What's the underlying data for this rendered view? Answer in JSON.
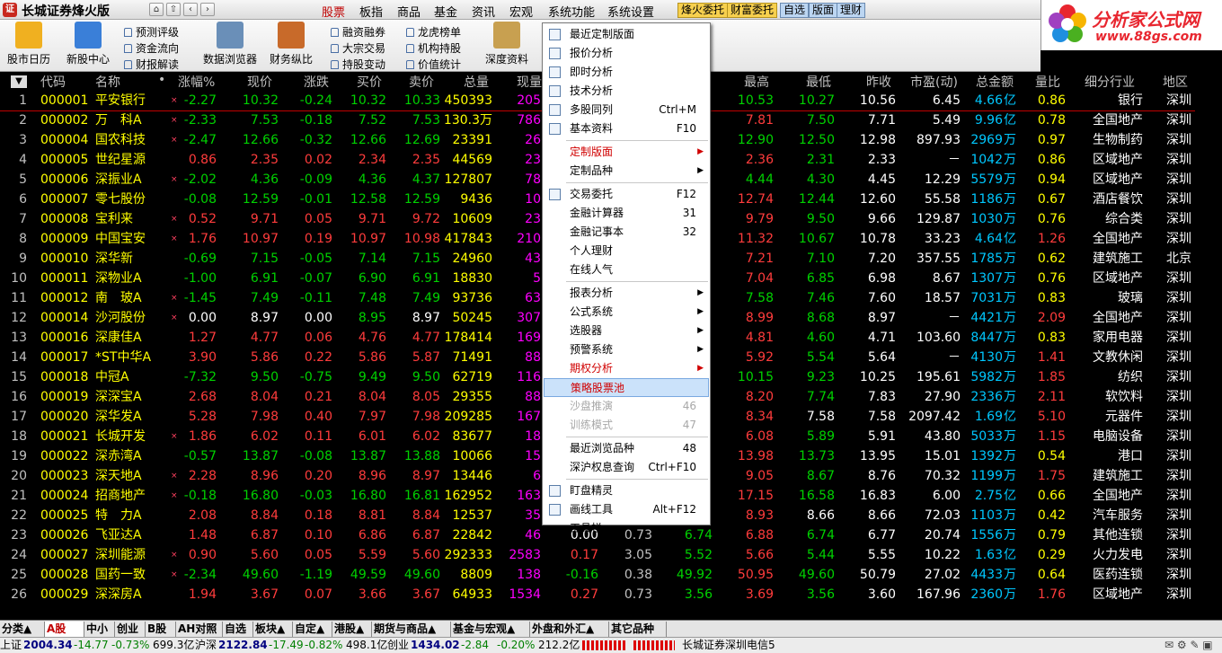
{
  "title": {
    "app": "长城证券烽火版",
    "logo": "证"
  },
  "menus": [
    "股票",
    "板指",
    "商品",
    "基金",
    "资讯",
    "宏观",
    "系统功能",
    "系统设置"
  ],
  "trade_buttons": [
    "烽火委托",
    "财富委托",
    "自选",
    "版面",
    "理财"
  ],
  "brand": {
    "name": "分析家公式网",
    "url": "www.88gs.com"
  },
  "toolbar": {
    "big": [
      "股市日历",
      "新股中心",
      "数据浏览器",
      "财务纵比",
      "深度资料"
    ],
    "small": [
      "预测评级",
      "资金流向",
      "财报解读",
      "融资融券",
      "大宗交易",
      "持股变动",
      "龙虎榜单",
      "机构持股",
      "价值统计"
    ]
  },
  "headers": {
    "idx": "▼",
    "code": "代码",
    "name": "名称",
    "dot": "•",
    "chg_pct": "涨幅%",
    "price": "现价",
    "chg": "涨跌",
    "bid": "买价",
    "ask": "卖价",
    "vol": "总量",
    "cur": "现量",
    "high": "最高",
    "low": "最低",
    "prev": "昨收",
    "pe": "市盈(动)",
    "amount": "总金额",
    "vr": "量比",
    "industry": "细分行业",
    "region": "地区"
  },
  "rows": [
    [
      "1",
      "000001",
      "平安银行",
      "×",
      "-2.27",
      "10.32",
      "-0.24",
      "10.32",
      "10.33",
      "450393",
      "205",
      "",
      "",
      "",
      "",
      "10.53",
      "10.27",
      "10.56",
      "6.45",
      "4.66",
      "亿",
      "0.86",
      "银行",
      "深圳"
    ],
    [
      "2",
      "000002",
      "万　科A",
      "×",
      "-2.33",
      "7.53",
      "-0.18",
      "7.52",
      "7.53",
      "130.3万",
      "786",
      "",
      "",
      "",
      "",
      "7.81",
      "7.50",
      "7.71",
      "5.49",
      "9.96",
      "亿",
      "0.78",
      "全国地产",
      "深圳"
    ],
    [
      "3",
      "000004",
      "国农科技",
      "×",
      "-2.47",
      "12.66",
      "-0.32",
      "12.66",
      "12.69",
      "23391",
      "26",
      "",
      "",
      "",
      "",
      "12.90",
      "12.50",
      "12.98",
      "897.93",
      "2969",
      "万",
      "0.97",
      "生物制药",
      "深圳"
    ],
    [
      "4",
      "000005",
      "世纪星源",
      "",
      "0.86",
      "2.35",
      "0.02",
      "2.34",
      "2.35",
      "44569",
      "23",
      "",
      "",
      "",
      "",
      "2.36",
      "2.31",
      "2.33",
      "－",
      "1042",
      "万",
      "0.86",
      "区域地产",
      "深圳"
    ],
    [
      "5",
      "000006",
      "深振业A",
      "×",
      "-2.02",
      "4.36",
      "-0.09",
      "4.36",
      "4.37",
      "127807",
      "78",
      "",
      "",
      "",
      "",
      "4.44",
      "4.30",
      "4.45",
      "12.29",
      "5579",
      "万",
      "0.94",
      "区域地产",
      "深圳"
    ],
    [
      "6",
      "000007",
      "零七股份",
      "",
      "-0.08",
      "12.59",
      "-0.01",
      "12.58",
      "12.59",
      "9436",
      "10",
      "",
      "",
      "",
      "",
      "12.74",
      "12.44",
      "12.60",
      "55.58",
      "1186",
      "万",
      "0.67",
      "酒店餐饮",
      "深圳"
    ],
    [
      "7",
      "000008",
      "宝利来",
      "×",
      "0.52",
      "9.71",
      "0.05",
      "9.71",
      "9.72",
      "10609",
      "23",
      "",
      "",
      "",
      "",
      "9.79",
      "9.50",
      "9.66",
      "129.87",
      "1030",
      "万",
      "0.76",
      "综合类",
      "深圳"
    ],
    [
      "8",
      "000009",
      "中国宝安",
      "×",
      "1.76",
      "10.97",
      "0.19",
      "10.97",
      "10.98",
      "417843",
      "210",
      "",
      "",
      "",
      "",
      "11.32",
      "10.67",
      "10.78",
      "33.23",
      "4.64",
      "亿",
      "1.26",
      "全国地产",
      "深圳"
    ],
    [
      "9",
      "000010",
      "深华新",
      "",
      "-0.69",
      "7.15",
      "-0.05",
      "7.14",
      "7.15",
      "24960",
      "43",
      "",
      "",
      "",
      "",
      "7.21",
      "7.10",
      "7.20",
      "357.55",
      "1785",
      "万",
      "0.62",
      "建筑施工",
      "北京"
    ],
    [
      "10",
      "000011",
      "深物业A",
      "",
      "-1.00",
      "6.91",
      "-0.07",
      "6.90",
      "6.91",
      "18830",
      "5",
      "",
      "",
      "",
      "",
      "7.04",
      "6.85",
      "6.98",
      "8.67",
      "1307",
      "万",
      "0.76",
      "区域地产",
      "深圳"
    ],
    [
      "11",
      "000012",
      "南　玻A",
      "×",
      "-1.45",
      "7.49",
      "-0.11",
      "7.48",
      "7.49",
      "93736",
      "63",
      "",
      "",
      "",
      "",
      "7.58",
      "7.46",
      "7.60",
      "18.57",
      "7031",
      "万",
      "0.83",
      "玻璃",
      "深圳"
    ],
    [
      "12",
      "000014",
      "沙河股份",
      "×",
      "0.00",
      "8.97",
      "0.00",
      "8.95",
      "8.97",
      "50245",
      "307",
      "",
      "",
      "",
      "",
      "8.99",
      "8.68",
      "8.97",
      "－",
      "4421",
      "万",
      "2.09",
      "全国地产",
      "深圳"
    ],
    [
      "13",
      "000016",
      "深康佳A",
      "",
      "1.27",
      "4.77",
      "0.06",
      "4.76",
      "4.77",
      "178414",
      "169",
      "",
      "",
      "",
      "",
      "4.81",
      "4.60",
      "4.71",
      "103.60",
      "8447",
      "万",
      "0.83",
      "家用电器",
      "深圳"
    ],
    [
      "14",
      "000017",
      "*ST中华A",
      "",
      "3.90",
      "5.86",
      "0.22",
      "5.86",
      "5.87",
      "71491",
      "88",
      "",
      "",
      "",
      "",
      "5.92",
      "5.54",
      "5.64",
      "－",
      "4130",
      "万",
      "1.41",
      "文教休闲",
      "深圳"
    ],
    [
      "15",
      "000018",
      "中冠A",
      "",
      "-7.32",
      "9.50",
      "-0.75",
      "9.49",
      "9.50",
      "62719",
      "116",
      "",
      "",
      "",
      "",
      "10.15",
      "9.23",
      "10.25",
      "195.61",
      "5982",
      "万",
      "1.85",
      "纺织",
      "深圳"
    ],
    [
      "16",
      "000019",
      "深深宝A",
      "",
      "2.68",
      "8.04",
      "0.21",
      "8.04",
      "8.05",
      "29355",
      "88",
      "",
      "",
      "",
      "",
      "8.20",
      "7.74",
      "7.83",
      "27.90",
      "2336",
      "万",
      "2.11",
      "软饮料",
      "深圳"
    ],
    [
      "17",
      "000020",
      "深华发A",
      "",
      "5.28",
      "7.98",
      "0.40",
      "7.97",
      "7.98",
      "209285",
      "167",
      "",
      "",
      "",
      "",
      "8.34",
      "7.58",
      "7.58",
      "2097.42",
      "1.69",
      "亿",
      "5.10",
      "元器件",
      "深圳"
    ],
    [
      "18",
      "000021",
      "长城开发",
      "×",
      "1.86",
      "6.02",
      "0.11",
      "6.01",
      "6.02",
      "83677",
      "18",
      "",
      "",
      "",
      "",
      "6.08",
      "5.89",
      "5.91",
      "43.80",
      "5033",
      "万",
      "1.15",
      "电脑设备",
      "深圳"
    ],
    [
      "19",
      "000022",
      "深赤湾A",
      "",
      "-0.57",
      "13.87",
      "-0.08",
      "13.87",
      "13.88",
      "10066",
      "15",
      "",
      "",
      "",
      "",
      "13.98",
      "13.73",
      "13.95",
      "15.01",
      "1392",
      "万",
      "0.54",
      "港口",
      "深圳"
    ],
    [
      "20",
      "000023",
      "深天地A",
      "×",
      "2.28",
      "8.96",
      "0.20",
      "8.96",
      "8.97",
      "13446",
      "6",
      "",
      "",
      "",
      "",
      "9.05",
      "8.67",
      "8.76",
      "70.32",
      "1199",
      "万",
      "1.75",
      "建筑施工",
      "深圳"
    ],
    [
      "21",
      "000024",
      "招商地产",
      "×",
      "-0.18",
      "16.80",
      "-0.03",
      "16.80",
      "16.81",
      "162952",
      "163",
      "",
      "",
      "",
      "",
      "17.15",
      "16.58",
      "16.83",
      "6.00",
      "2.75",
      "亿",
      "0.66",
      "全国地产",
      "深圳"
    ],
    [
      "22",
      "000025",
      "特　力A",
      "",
      "2.08",
      "8.84",
      "0.18",
      "8.81",
      "8.84",
      "12537",
      "35",
      "",
      "",
      "",
      "",
      "8.93",
      "8.66",
      "8.66",
      "72.03",
      "1103",
      "万",
      "0.42",
      "汽车服务",
      "深圳"
    ],
    [
      "23",
      "000026",
      "飞亚达A",
      "",
      "1.48",
      "6.87",
      "0.10",
      "6.86",
      "6.87",
      "22842",
      "46",
      "0.00",
      "0.73",
      "6.74",
      "",
      "6.88",
      "6.74",
      "6.77",
      "20.74",
      "1556",
      "万",
      "0.79",
      "其他连锁",
      "深圳"
    ],
    [
      "24",
      "000027",
      "深圳能源",
      "×",
      "0.90",
      "5.60",
      "0.05",
      "5.59",
      "5.60",
      "292333",
      "2583",
      "0.17",
      "3.05",
      "5.52",
      "",
      "5.66",
      "5.44",
      "5.55",
      "10.22",
      "1.63",
      "亿",
      "0.29",
      "火力发电",
      "深圳"
    ],
    [
      "25",
      "000028",
      "国药一致",
      "×",
      "-2.34",
      "49.60",
      "-1.19",
      "49.59",
      "49.60",
      "8809",
      "138",
      "-0.16",
      "0.38",
      "49.92",
      "",
      "50.95",
      "49.60",
      "50.79",
      "27.02",
      "4433",
      "万",
      "0.64",
      "医药连锁",
      "深圳"
    ],
    [
      "26",
      "000029",
      "深深房A",
      "",
      "1.94",
      "3.67",
      "0.07",
      "3.66",
      "3.67",
      "64933",
      "1534",
      "0.27",
      "0.73",
      "3.56",
      "",
      "3.69",
      "3.56",
      "3.60",
      "167.96",
      "2360",
      "万",
      "1.76",
      "区域地产",
      "深圳"
    ]
  ],
  "popup_menu": [
    {
      "label": "最近定制版面",
      "shortcut": "",
      "sub": false,
      "style": "",
      "icon": true
    },
    {
      "label": "报价分析",
      "shortcut": "",
      "sub": false,
      "style": "",
      "icon": true
    },
    {
      "label": "即时分析",
      "shortcut": "",
      "sub": false,
      "style": "",
      "icon": true
    },
    {
      "label": "技术分析",
      "shortcut": "",
      "sub": false,
      "style": "",
      "icon": true
    },
    {
      "label": "多股同列",
      "shortcut": "Ctrl+M",
      "sub": false,
      "style": "",
      "icon": true
    },
    {
      "label": "基本资料",
      "shortcut": "F10",
      "sub": false,
      "style": "",
      "icon": true
    },
    {
      "sep": true
    },
    {
      "label": "定制版面",
      "shortcut": "",
      "sub": true,
      "style": "red",
      "icon": false
    },
    {
      "label": "定制品种",
      "shortcut": "",
      "sub": true,
      "style": "",
      "icon": false
    },
    {
      "sep": true
    },
    {
      "label": "交易委托",
      "shortcut": "F12",
      "sub": false,
      "style": "",
      "icon": true
    },
    {
      "label": "金融计算器",
      "shortcut": "31",
      "sub": false,
      "style": "",
      "icon": false
    },
    {
      "label": "金融记事本",
      "shortcut": "32",
      "sub": false,
      "style": "",
      "icon": false
    },
    {
      "label": "个人理财",
      "shortcut": "",
      "sub": false,
      "style": "",
      "icon": false
    },
    {
      "label": "在线人气",
      "shortcut": "",
      "sub": false,
      "style": "",
      "icon": false
    },
    {
      "sep": true
    },
    {
      "label": "报表分析",
      "shortcut": "",
      "sub": true,
      "style": "",
      "icon": false
    },
    {
      "label": "公式系统",
      "shortcut": "",
      "sub": true,
      "style": "",
      "icon": false
    },
    {
      "label": "选股器",
      "shortcut": "",
      "sub": true,
      "style": "",
      "icon": false
    },
    {
      "label": "预警系统",
      "shortcut": "",
      "sub": true,
      "style": "",
      "icon": false
    },
    {
      "label": "期权分析",
      "shortcut": "",
      "sub": true,
      "style": "red",
      "icon": false
    },
    {
      "label": "策略股票池",
      "shortcut": "",
      "sub": false,
      "style": "red sel",
      "icon": false
    },
    {
      "label": "沙盘推演",
      "shortcut": "46",
      "sub": false,
      "style": "dis",
      "icon": false
    },
    {
      "label": "训练模式",
      "shortcut": "47",
      "sub": false,
      "style": "dis",
      "icon": false
    },
    {
      "sep": true
    },
    {
      "label": "最近浏览品种",
      "shortcut": "48",
      "sub": false,
      "style": "",
      "icon": false
    },
    {
      "label": "深沪权息查询",
      "shortcut": "Ctrl+F10",
      "sub": false,
      "style": "",
      "icon": false
    },
    {
      "sep": true
    },
    {
      "label": "盯盘精灵",
      "shortcut": "",
      "sub": false,
      "style": "",
      "icon": true
    },
    {
      "label": "画线工具",
      "shortcut": "Alt+F12",
      "sub": false,
      "style": "",
      "icon": true
    },
    {
      "label": "工具栏",
      "shortcut": "",
      "sub": false,
      "style": "",
      "icon": false
    }
  ],
  "bottom_tabs": [
    "分类▲",
    "A股",
    "中小",
    "创业",
    "B股",
    "AH对照",
    "自选",
    "板块▲",
    "自定▲",
    "港股▲",
    "期货与商品▲",
    "基金与宏观▲",
    "外盘和外汇▲",
    "其它品种"
  ],
  "status": {
    "sh_label": "上证",
    "sh_val": "2004.34",
    "sh_chg": "-14.77",
    "sh_pct": "-0.73%",
    "sh_amt": "699.3亿",
    "hs_label": "沪深",
    "hs_val": "2122.84",
    "hs_chg": "-17.49",
    "hs_pct": "-0.82%",
    "hs_amt": "498.1亿",
    "cy_label": "创业",
    "cy_val": "1434.02",
    "cy_chg": "-2.84",
    "cy_pct": "-0.20%",
    "cy_amt": "212.2亿",
    "broker": "长城证券深圳电信5"
  },
  "colors": {
    "up": "#ff3c3c",
    "down": "#00d200",
    "flat": "#ffffff",
    "code": "#ffff00",
    "name": "#ffff00",
    "vol": "#ffff00",
    "cur": "#ff00ff",
    "amount": "#00c8ff",
    "text": "#c0c0c0"
  }
}
